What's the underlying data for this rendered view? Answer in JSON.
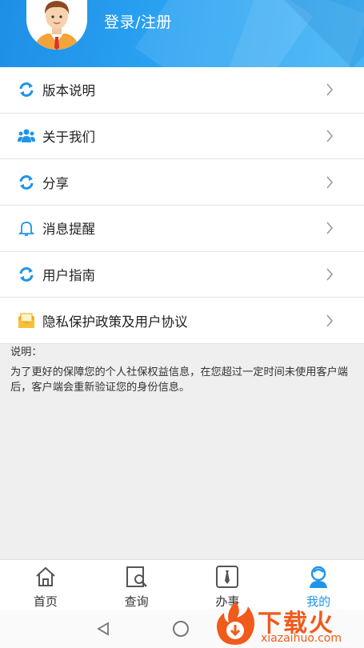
{
  "header": {
    "login_label": "登录/注册"
  },
  "menu": [
    {
      "label": "版本说明",
      "icon": "refresh-icon"
    },
    {
      "label": "关于我们",
      "icon": "people-icon"
    },
    {
      "label": "分享",
      "icon": "refresh-icon"
    },
    {
      "label": "消息提醒",
      "icon": "bell-icon"
    },
    {
      "label": "用户指南",
      "icon": "refresh-icon"
    },
    {
      "label": "隐私保护政策及用户协议",
      "icon": "envelope-icon"
    }
  ],
  "notes": {
    "title": "说明：",
    "body": "为了更好的保障您的个人社保权益信息，在您超过一定时间未使用客户端后，客户端会重新验证您的身份信息。"
  },
  "tabbar": {
    "active_color": "#1e95ea",
    "tabs": [
      {
        "label": "首页",
        "icon": "home-icon"
      },
      {
        "label": "查询",
        "icon": "search-doc-icon"
      },
      {
        "label": "办事",
        "icon": "tie-icon"
      },
      {
        "label": "我的",
        "icon": "user-icon",
        "active": true
      }
    ]
  },
  "watermark": {
    "brand": "下载火",
    "domain": "xiazaihuo.com"
  }
}
